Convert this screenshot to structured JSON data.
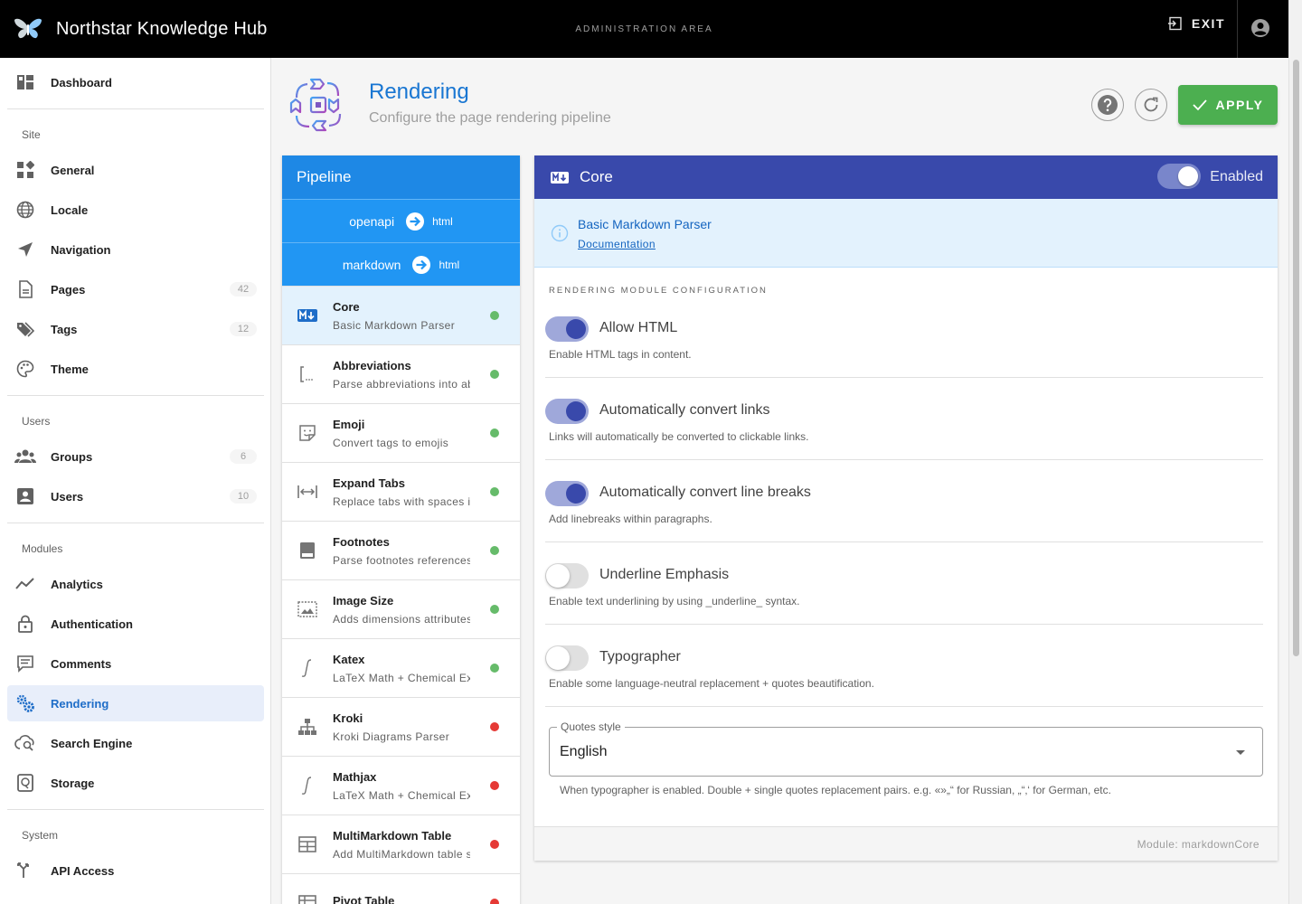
{
  "app": {
    "title": "Northstar Knowledge Hub",
    "area": "ADMINISTRATION AREA",
    "exit_label": "EXIT",
    "exit_icon": "logout-icon",
    "account_icon": "account-circle-icon"
  },
  "sidebar": {
    "top": {
      "label": "Dashboard",
      "icon": "dashboard-icon"
    },
    "sections": [
      {
        "title": "Site",
        "items": [
          {
            "label": "General",
            "icon": "widgets-icon"
          },
          {
            "label": "Locale",
            "icon": "globe-icon"
          },
          {
            "label": "Navigation",
            "icon": "send-icon"
          },
          {
            "label": "Pages",
            "icon": "file-icon",
            "badge": "42"
          },
          {
            "label": "Tags",
            "icon": "tags-icon",
            "badge": "12"
          },
          {
            "label": "Theme",
            "icon": "palette-icon"
          }
        ]
      },
      {
        "title": "Users",
        "items": [
          {
            "label": "Groups",
            "icon": "groups-icon",
            "badge": "6"
          },
          {
            "label": "Users",
            "icon": "user-box-icon",
            "badge": "10"
          }
        ]
      },
      {
        "title": "Modules",
        "items": [
          {
            "label": "Analytics",
            "icon": "chart-line-icon"
          },
          {
            "label": "Authentication",
            "icon": "lock-icon"
          },
          {
            "label": "Comments",
            "icon": "comment-icon"
          },
          {
            "label": "Rendering",
            "icon": "cogs-icon",
            "active": true
          },
          {
            "label": "Search Engine",
            "icon": "cloud-search-icon"
          },
          {
            "label": "Storage",
            "icon": "storage-icon"
          }
        ]
      },
      {
        "title": "System",
        "items": [
          {
            "label": "API Access",
            "icon": "api-icon"
          }
        ]
      }
    ]
  },
  "header": {
    "title": "Rendering",
    "subtitle": "Configure the page rendering pipeline",
    "apply_label": "APPLY",
    "help_icon": "help-icon",
    "refresh_icon": "refresh-icon"
  },
  "pipeline": {
    "title": "Pipeline",
    "flows": [
      {
        "from": "openapi",
        "to": "html"
      },
      {
        "from": "markdown",
        "to": "html"
      }
    ],
    "items": [
      {
        "title": "Core",
        "subtitle": "Basic Markdown Parser",
        "icon": "markdown-icon",
        "status": "enabled",
        "active": true
      },
      {
        "title": "Abbreviations",
        "subtitle": "Parse abbreviations into abbr tags",
        "icon": "code-brackets-icon",
        "status": "enabled"
      },
      {
        "title": "Emoji",
        "subtitle": "Convert tags to emojis",
        "icon": "sticker-emoji-icon",
        "status": "enabled"
      },
      {
        "title": "Expand Tabs",
        "subtitle": "Replace tabs with spaces in code blocks",
        "icon": "arrow-expand-horizontal-icon",
        "status": "enabled"
      },
      {
        "title": "Footnotes",
        "subtitle": "Parse footnotes references",
        "icon": "note-icon",
        "status": "enabled"
      },
      {
        "title": "Image Size",
        "subtitle": "Adds dimensions attributes to images",
        "icon": "image-size-icon",
        "status": "enabled"
      },
      {
        "title": "Katex",
        "subtitle": "LaTeX Math + Chemical Expression Parser",
        "icon": "function-icon",
        "status": "enabled"
      },
      {
        "title": "Kroki",
        "subtitle": "Kroki Diagrams Parser",
        "icon": "sitemap-icon",
        "status": "disabled"
      },
      {
        "title": "Mathjax",
        "subtitle": "LaTeX Math + Chemical Expression Parser",
        "icon": "function-icon",
        "status": "disabled"
      },
      {
        "title": "MultiMarkdown Table",
        "subtitle": "Add MultiMarkdown table support",
        "icon": "table-icon",
        "status": "disabled"
      },
      {
        "title": "Pivot Table",
        "subtitle": "",
        "icon": "table-pivot-icon",
        "status": "disabled"
      }
    ]
  },
  "core": {
    "title": "Core",
    "enabled_label": "Enabled",
    "info_title": "Basic Markdown Parser",
    "info_link": "Documentation",
    "section_label": "RENDERING MODULE CONFIGURATION",
    "options": [
      {
        "label": "Allow HTML",
        "hint": "Enable HTML tags in content.",
        "on": true
      },
      {
        "label": "Automatically convert links",
        "hint": "Links will automatically be converted to clickable links.",
        "on": true
      },
      {
        "label": "Automatically convert line breaks",
        "hint": "Add linebreaks within paragraphs.",
        "on": true
      },
      {
        "label": "Underline Emphasis",
        "hint": "Enable text underlining by using _underline_ syntax.",
        "on": false
      },
      {
        "label": "Typographer",
        "hint": "Enable some language-neutral replacement + quotes beautification.",
        "on": false
      }
    ],
    "quotes": {
      "legend": "Quotes style",
      "value": "English",
      "hint": "When typographer is enabled. Double + single quotes replacement pairs. e.g. «»„“ for Russian, „“‚‘ for German, etc."
    },
    "module_id": "Module: markdownCore"
  },
  "colors": {
    "topbar": "#000000",
    "pipeline_header": "#1e88e5",
    "core_header": "#3949ab",
    "apply": "#4caf50",
    "status_enabled": "#66bb6a",
    "status_disabled": "#e53935"
  }
}
